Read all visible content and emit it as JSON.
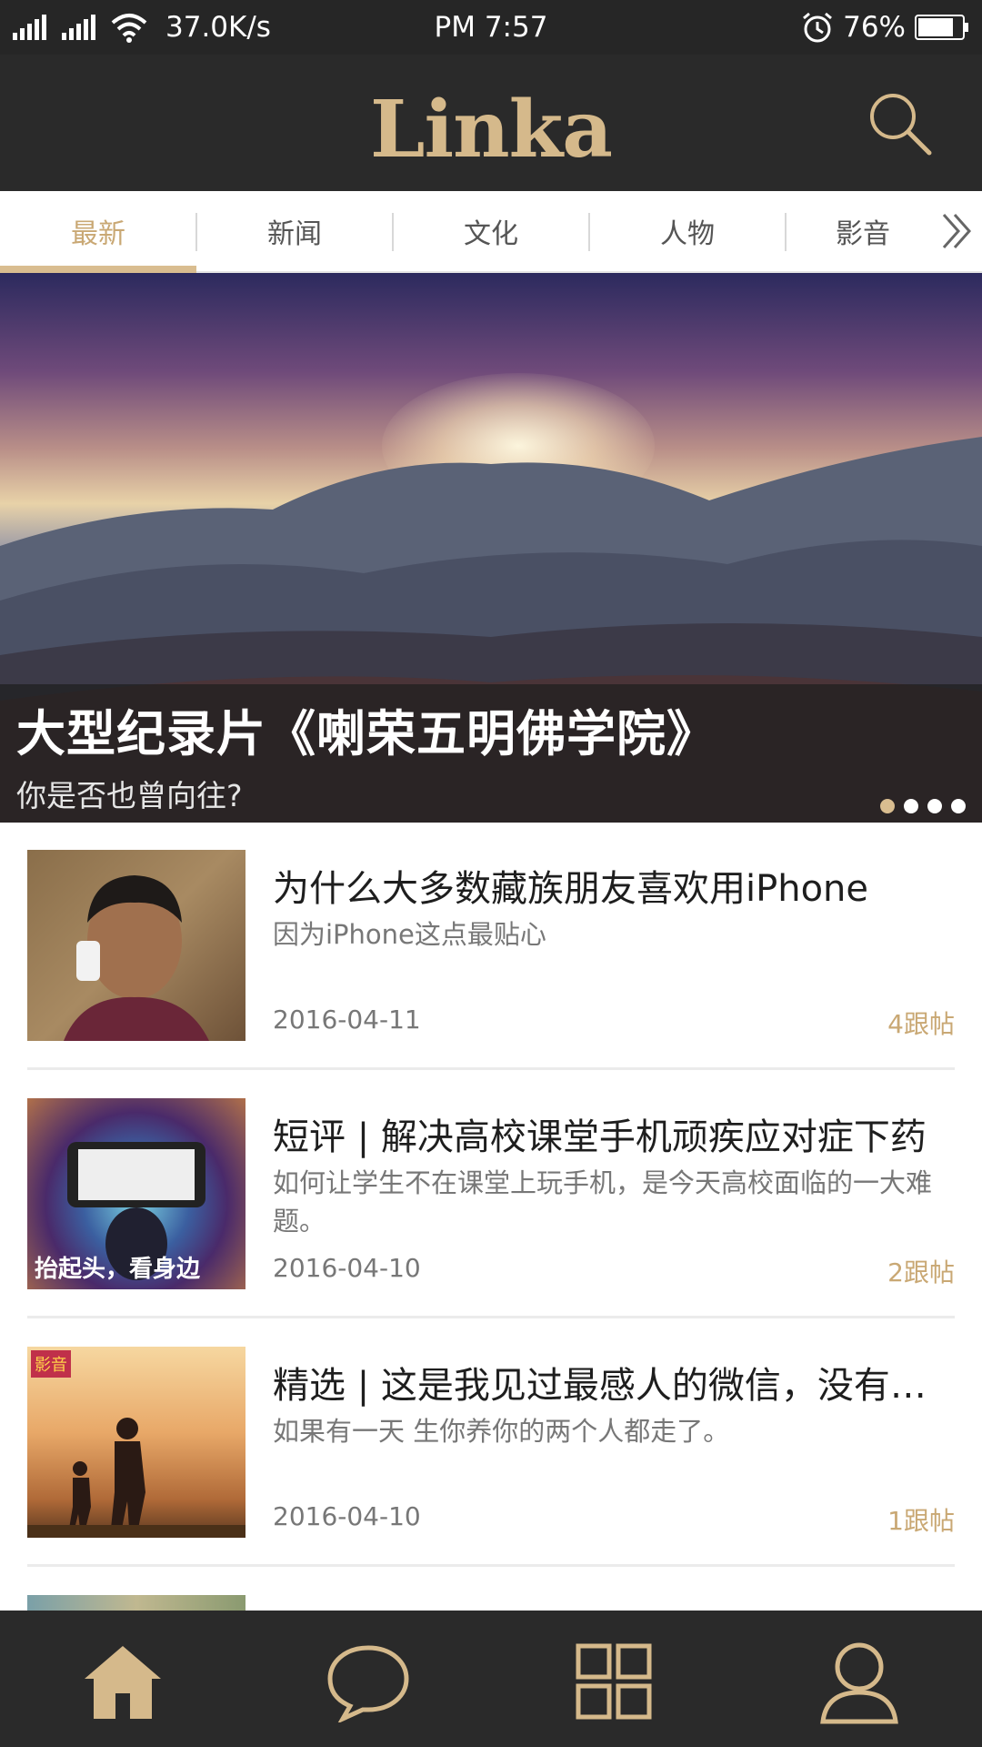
{
  "status_bar": {
    "net_speed": "37.0K/s",
    "time": "PM 7:57",
    "battery": "76%"
  },
  "header": {
    "logo_text": "Linka",
    "search_icon": "search-icon"
  },
  "tabs": {
    "items": [
      {
        "label": "最新",
        "active": true
      },
      {
        "label": "新闻",
        "active": false
      },
      {
        "label": "文化",
        "active": false
      },
      {
        "label": "人物",
        "active": false
      },
      {
        "label": "影音",
        "active": false
      }
    ],
    "more_icon": "double-chevron-right-icon"
  },
  "banner": {
    "title": "大型纪录片《喇荣五明佛学院》",
    "subtitle": "你是否也曾向往?",
    "slide_count": 4,
    "active_slide": 1
  },
  "articles": [
    {
      "title": "为什么大多数藏族朋友喜欢用iPhone",
      "summary": "因为iPhone这点最贴心",
      "date": "2016-04-11",
      "replies": "4跟帖"
    },
    {
      "title": "短评 | 解决高校课堂手机顽疾应对症下药",
      "summary": "如何让学生不在课堂上玩手机，是今天高校面临的一大难题。",
      "date": "2016-04-10",
      "replies": "2跟帖",
      "thumb_text": "抬起头，看身边"
    },
    {
      "title": "精选 | 这是我见过最感人的微信，没有之…",
      "summary": "如果有一天 生你养你的两个人都走了。",
      "date": "2016-04-10",
      "replies": "1跟帖",
      "thumb_badge": "影音"
    }
  ],
  "bottom_nav": {
    "items": [
      "home-icon",
      "chat-bubble-icon",
      "grid-icon",
      "user-icon"
    ]
  },
  "colors": {
    "accent": "#d5b98b",
    "dark_bar": "#2a2a2a"
  }
}
